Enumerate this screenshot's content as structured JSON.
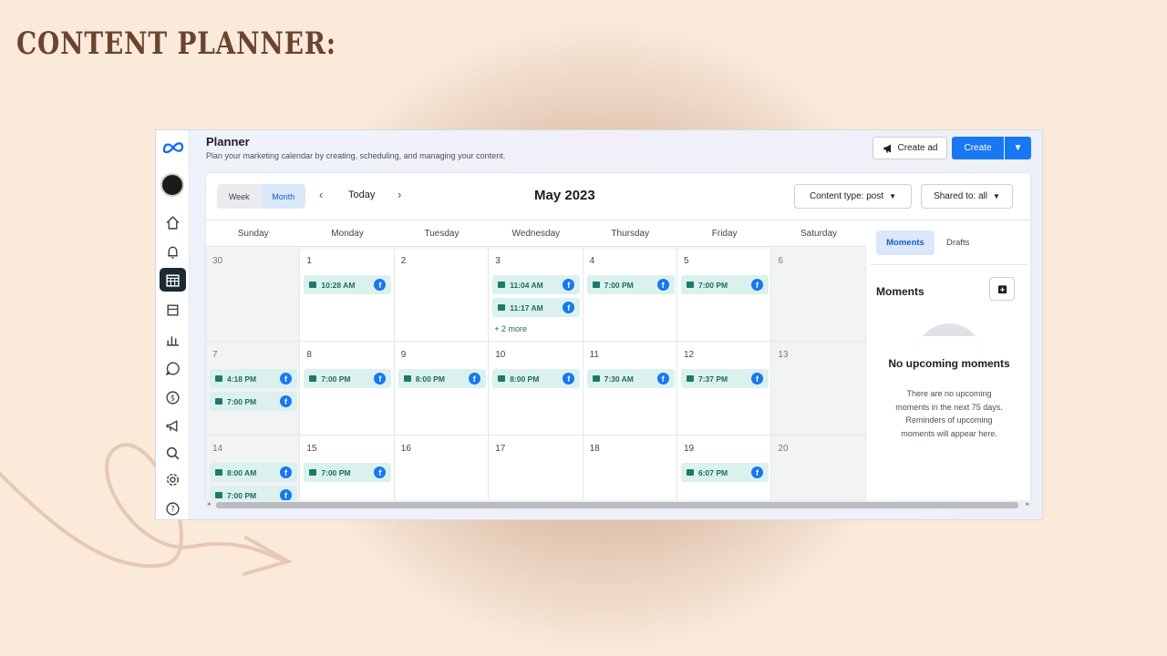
{
  "headline": "CONTENT PLANNER:",
  "app": {
    "title": "Planner",
    "subtitle": "Plan your marketing calendar by creating, scheduling, and managing your content.",
    "create_ad_label": "Create ad",
    "create_label": "Create",
    "accent_color": "#1877f2",
    "event_color": "#daf1ed"
  },
  "rail_icons": [
    "meta-logo-icon",
    "account-avatar",
    "home-icon",
    "notifications-icon",
    "planner-icon",
    "content-icon",
    "insights-icon",
    "inbox-icon",
    "monetization-icon",
    "ads-icon",
    "search-icon",
    "settings-icon",
    "help-icon"
  ],
  "toolbar": {
    "week_label": "Week",
    "month_label": "Month",
    "today_label": "Today",
    "month_title": "May 2023",
    "content_type_filter": "Content type: post",
    "shared_to_filter": "Shared to: all"
  },
  "weekdays": [
    "Sunday",
    "Monday",
    "Tuesday",
    "Wednesday",
    "Thursday",
    "Friday",
    "Saturday"
  ],
  "days": [
    {
      "num": "30",
      "events": []
    },
    {
      "num": "1",
      "events": [
        "10:28 AM"
      ]
    },
    {
      "num": "2",
      "events": []
    },
    {
      "num": "3",
      "events": [
        "11:04 AM",
        "11:17 AM"
      ],
      "more": "+ 2 more"
    },
    {
      "num": "4",
      "events": [
        "7:00 PM"
      ]
    },
    {
      "num": "5",
      "events": [
        "7:00 PM"
      ]
    },
    {
      "num": "6",
      "events": []
    },
    {
      "num": "7",
      "events": [
        "4:18 PM",
        "7:00 PM"
      ]
    },
    {
      "num": "8",
      "events": [
        "7:00 PM"
      ]
    },
    {
      "num": "9",
      "events": [
        "8:00 PM"
      ]
    },
    {
      "num": "10",
      "events": [
        "8:00 PM"
      ]
    },
    {
      "num": "11",
      "events": [
        "7:30 AM"
      ]
    },
    {
      "num": "12",
      "events": [
        "7:37 PM"
      ]
    },
    {
      "num": "13",
      "events": []
    },
    {
      "num": "14",
      "events": [
        "8:00 AM",
        "7:00 PM"
      ]
    },
    {
      "num": "15",
      "events": [
        "7:00 PM"
      ]
    },
    {
      "num": "16",
      "events": []
    },
    {
      "num": "17",
      "events": []
    },
    {
      "num": "18",
      "events": []
    },
    {
      "num": "19",
      "events": [
        "6:07 PM"
      ]
    },
    {
      "num": "20",
      "events": []
    }
  ],
  "side": {
    "tab_moments": "Moments",
    "tab_drafts": "Drafts",
    "moments_title": "Moments",
    "empty_title": "No upcoming moments",
    "empty_desc": "There are no upcoming moments in the next 75 days. Reminders of upcoming moments will appear here."
  }
}
